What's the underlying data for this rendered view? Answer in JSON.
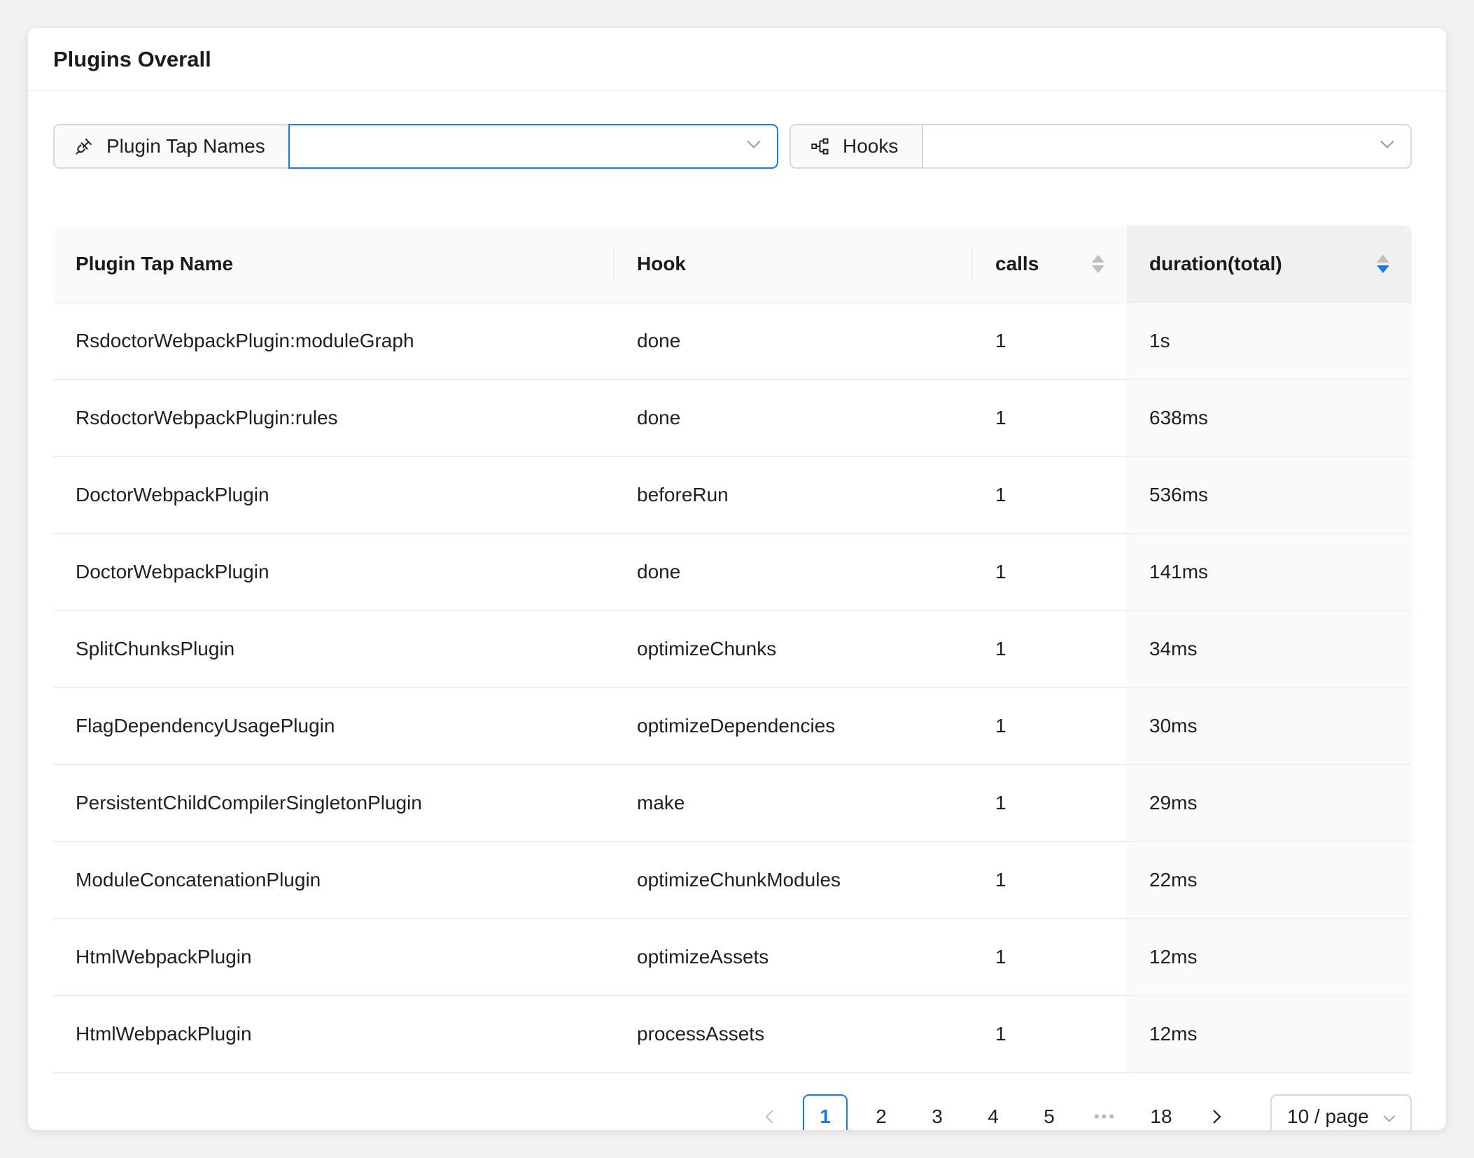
{
  "panel": {
    "title": "Plugins Overall"
  },
  "filters": {
    "plugin_tap_names": {
      "label": "Plugin Tap Names",
      "value": ""
    },
    "hooks": {
      "label": "Hooks",
      "value": ""
    }
  },
  "table": {
    "columns": [
      "Plugin Tap Name",
      "Hook",
      "calls",
      "duration(total)"
    ],
    "sorted_column": "duration(total)",
    "sort_direction": "descending",
    "rows": [
      {
        "plugin": "RsdoctorWebpackPlugin:moduleGraph",
        "hook": "done",
        "calls": "1",
        "duration": "1s"
      },
      {
        "plugin": "RsdoctorWebpackPlugin:rules",
        "hook": "done",
        "calls": "1",
        "duration": "638ms"
      },
      {
        "plugin": "DoctorWebpackPlugin",
        "hook": "beforeRun",
        "calls": "1",
        "duration": "536ms"
      },
      {
        "plugin": "DoctorWebpackPlugin",
        "hook": "done",
        "calls": "1",
        "duration": "141ms"
      },
      {
        "plugin": "SplitChunksPlugin",
        "hook": "optimizeChunks",
        "calls": "1",
        "duration": "34ms"
      },
      {
        "plugin": "FlagDependencyUsagePlugin",
        "hook": "optimizeDependencies",
        "calls": "1",
        "duration": "30ms"
      },
      {
        "plugin": "PersistentChildCompilerSingletonPlugin",
        "hook": "make",
        "calls": "1",
        "duration": "29ms"
      },
      {
        "plugin": "ModuleConcatenationPlugin",
        "hook": "optimizeChunkModules",
        "calls": "1",
        "duration": "22ms"
      },
      {
        "plugin": "HtmlWebpackPlugin",
        "hook": "optimizeAssets",
        "calls": "1",
        "duration": "12ms"
      },
      {
        "plugin": "HtmlWebpackPlugin",
        "hook": "processAssets",
        "calls": "1",
        "duration": "12ms"
      }
    ]
  },
  "pagination": {
    "pages": [
      "1",
      "2",
      "3",
      "4",
      "5"
    ],
    "ellipsis": "•••",
    "last_page": "18",
    "current_page": "1",
    "page_size": "10 / page"
  },
  "colors": {
    "accent": "#1677ff",
    "border": "#d9d9d9",
    "header_bg": "#fafafa"
  },
  "icons": {
    "plugin_filter": "plug-icon",
    "hooks_filter": "hierarchy-icon"
  }
}
